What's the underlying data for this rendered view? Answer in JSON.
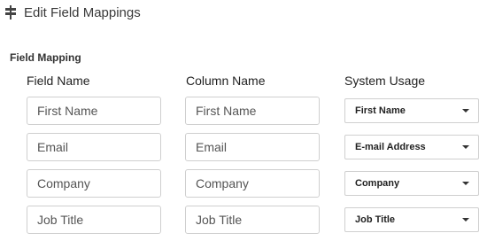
{
  "header": {
    "title": "Edit Field Mappings",
    "icon": "signpost-icon"
  },
  "section": {
    "title": "Field Mapping"
  },
  "columns": {
    "field_name": "Field Name",
    "column_name": "Column Name",
    "system_usage": "System Usage"
  },
  "rows": [
    {
      "field_name": "First Name",
      "column_name": "First Name",
      "system_usage": "First Name"
    },
    {
      "field_name": "Email",
      "column_name": "Email",
      "system_usage": "E-mail Address"
    },
    {
      "field_name": "Company",
      "column_name": "Company",
      "system_usage": "Company"
    },
    {
      "field_name": "Job Title",
      "column_name": "Job Title",
      "system_usage": "Job Title"
    }
  ]
}
